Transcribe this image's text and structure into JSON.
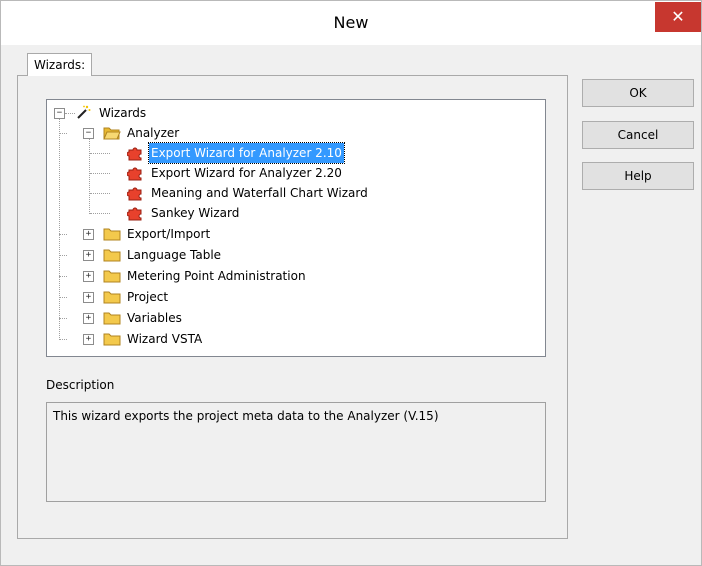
{
  "window": {
    "title": "New",
    "close_symbol": "✕"
  },
  "tab": {
    "label": "Wizards:"
  },
  "tree": {
    "root": "Wizards",
    "analyzer": "Analyzer",
    "analyzer_items": [
      "Export Wizard for Analyzer 2.10",
      "Export Wizard for Analyzer 2.20",
      "Meaning and Waterfall Chart Wizard",
      "Sankey Wizard"
    ],
    "folders": [
      "Export/Import",
      "Language Table",
      "Metering Point Administration",
      "Project",
      "Variables",
      "Wizard VSTA"
    ],
    "collapse_symbol": "−",
    "expand_symbol": "+"
  },
  "buttons": {
    "ok": "OK",
    "cancel": "Cancel",
    "help": "Help"
  },
  "description": {
    "label": "Description",
    "text": "This wizard exports the project meta data to the Analyzer  (V.15)"
  },
  "colors": {
    "selection": "#3399ff",
    "close": "#c7372f",
    "folder": "#f3c94c",
    "puzzle": "#e8412c"
  }
}
